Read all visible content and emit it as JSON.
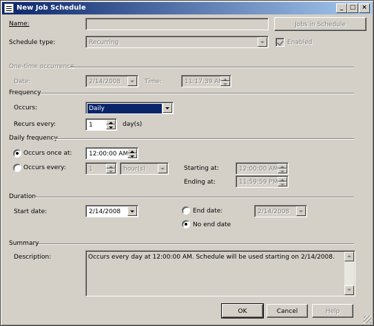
{
  "window": {
    "title": "New Job Schedule"
  },
  "name": {
    "label": "Name:",
    "value": "",
    "jobs_button": "Jobs in Schedule"
  },
  "schedule_type": {
    "label": "Schedule type:",
    "value": "Recurring",
    "enabled_label": "Enabled",
    "enabled_checked": true
  },
  "one_time": {
    "section": "One-time occurrence",
    "date_label": "Date:",
    "date_value": "2/14/2008",
    "time_label": "Time:",
    "time_value": "11:17:39 AM"
  },
  "frequency": {
    "section": "Frequency",
    "occurs_label": "Occurs:",
    "occurs_value": "Daily",
    "recurs_label": "Recurs every:",
    "recurs_value": "1",
    "recurs_unit": "day(s)"
  },
  "daily_frequency": {
    "section": "Daily frequency",
    "once_label": "Occurs once at:",
    "once_value": "12:00:00 AM",
    "once_selected": true,
    "every_label": "Occurs every:",
    "every_value": "1",
    "every_unit": "hour(s)",
    "starting_label": "Starting at:",
    "starting_value": "12:00:00 AM",
    "ending_label": "Ending at:",
    "ending_value": "11:59:59 PM"
  },
  "duration": {
    "section": "Duration",
    "start_label": "Start date:",
    "start_value": "2/14/2008",
    "end_label": "End date:",
    "end_value": "2/14/2008",
    "no_end_label": "No end date",
    "no_end_selected": true
  },
  "summary": {
    "section": "Summary",
    "description_label": "Description:",
    "description": "Occurs every day at 12:00:00 AM. Schedule will be used starting on 2/14/2008."
  },
  "buttons": {
    "ok": "OK",
    "cancel": "Cancel",
    "help": "Help"
  }
}
